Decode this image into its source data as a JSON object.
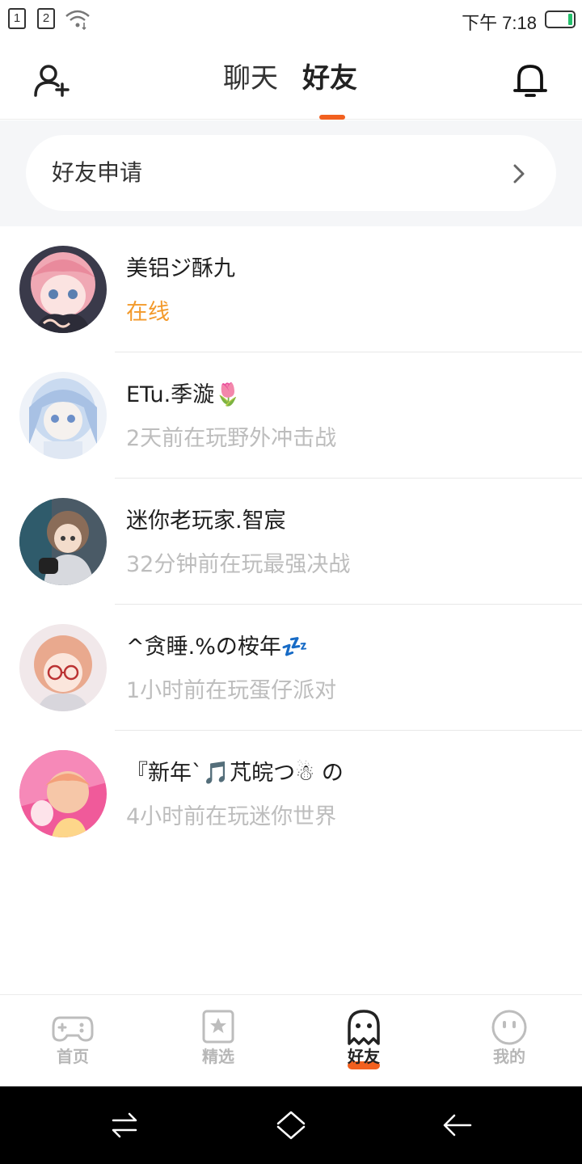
{
  "status_bar": {
    "sim1": "1",
    "sim2": "2",
    "time": "下午 7:18",
    "battery_color": "#25c06d"
  },
  "header": {
    "tabs": [
      {
        "label": "聊天",
        "active": false
      },
      {
        "label": "好友",
        "active": true
      }
    ],
    "accent": "#f2601f",
    "left_icon": "add-friend-icon",
    "right_icon": "bell-icon"
  },
  "friend_request": {
    "label": "好友申请",
    "icon": "chevron-right-icon"
  },
  "friends": [
    {
      "name": "美铝ジ酥九",
      "status": "在线",
      "online": true
    },
    {
      "name": "ETu.季漩🌷",
      "status": "2天前在玩野外冲击战",
      "online": false
    },
    {
      "name": "迷你老玩家.智宸",
      "status": "32分钟前在玩最强决战",
      "online": false
    },
    {
      "name": "^贪睡.%の桉年💤",
      "status": "1小时前在玩蛋仔派对",
      "online": false
    },
    {
      "name": "『新年`🎵芃皖つ☃ の",
      "status": "4小时前在玩迷你世界",
      "online": false
    }
  ],
  "bottom_nav": [
    {
      "label": "首页",
      "icon": "gamepad-icon",
      "active": false
    },
    {
      "label": "精选",
      "icon": "star-bookmark-icon",
      "active": false
    },
    {
      "label": "好友",
      "icon": "ghost-icon",
      "active": true
    },
    {
      "label": "我的",
      "icon": "face-icon",
      "active": false
    }
  ],
  "colors": {
    "online_status": "#f39a2b",
    "offline_status": "#bdbdbd",
    "nav_inactive": "#b7b7b7"
  }
}
